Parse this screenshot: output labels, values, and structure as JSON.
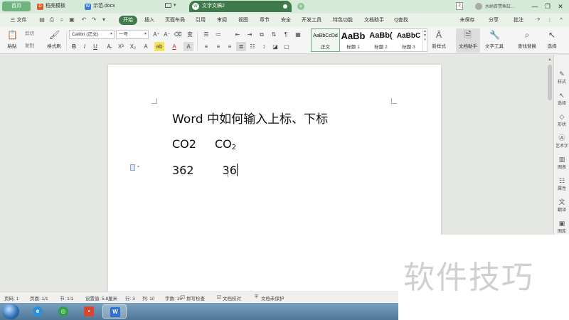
{
  "titlebar": {
    "home_tab": "首页",
    "templates_tab": "稻壳模板",
    "doc_tab": "示范.docx",
    "active_tab": "文字文稿2",
    "badge": "2",
    "user": "水纳百赞鱼缸…",
    "chevron": "▾",
    "minimize": "—",
    "restore": "❐",
    "close": "✕"
  },
  "menubar": {
    "file": "三 文件",
    "items": [
      "开始",
      "插入",
      "页面布局",
      "引用",
      "审阅",
      "视图",
      "章节",
      "安全",
      "开发工具",
      "特色功能",
      "文档助手"
    ],
    "search": "Q查找",
    "unsaved": "未保存",
    "share": "分享",
    "comment": "批注",
    "help": "?",
    "more": "⋮",
    "collapse": "^"
  },
  "ribbon": {
    "paste": "粘贴",
    "cut": "剪切",
    "copy": "复制",
    "format_painter": "格式刷",
    "font_name": "Calibri (正文)",
    "font_size": "一号",
    "grow": "A⁺",
    "shrink": "A⁻",
    "clear": "⌫",
    "phonetic": "变",
    "bold": "B",
    "italic": "I",
    "underline": "U",
    "strike": "A̶",
    "superscript": "X²",
    "subscript": "X₂",
    "text_effect": "A",
    "highlight": "ab",
    "font_color": "A",
    "char_shade": "A",
    "styles": [
      {
        "sample": "AaBbCcDd",
        "name": "正文"
      },
      {
        "sample": "AaBb",
        "name": "标题 1"
      },
      {
        "sample": "AaBb(",
        "name": "标题 2"
      },
      {
        "sample": "AaBbC",
        "name": "标题 3"
      }
    ],
    "new_style": "新样式",
    "doc_assistant": "文档助手",
    "text_tools": "文字工具",
    "find_replace": "查找替换",
    "select": "选择"
  },
  "document": {
    "line1": "Word 中如何输入上标、下标",
    "line2_plain": "CO2",
    "line2_base": "CO",
    "line2_sub": "2",
    "line3_a": "362",
    "line3_b": "36"
  },
  "right_rail": {
    "items": [
      "样式",
      "选择",
      "形状",
      "艺术字",
      "图表",
      "属性",
      "翻译",
      "图库"
    ]
  },
  "statusbar": {
    "page": "页码: 1",
    "pages": "页面: 1/1",
    "section": "节: 1/1",
    "setting": "设置值: 5.8厘米",
    "row": "行: 3",
    "col": "列: 10",
    "words": "字数: 15",
    "spell": "拼写检查",
    "proof": "文档校对",
    "protect": "文档未保护"
  },
  "watermark": "软件技巧",
  "colors": {
    "accent_green": "#3e7a4a",
    "home_green": "#6fb37e",
    "taskbar_blue": "#5a84a4"
  },
  "icons": {
    "start": "windows-start-icon",
    "ie": "ie-icon",
    "wps_app": "wps-app-icon",
    "word": "wps-writer-icon"
  }
}
